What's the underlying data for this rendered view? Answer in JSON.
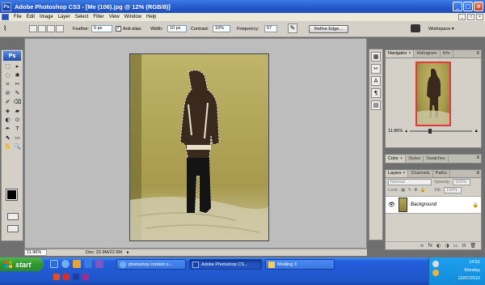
{
  "window": {
    "app_badge": "Ps",
    "title": "Adobe Photoshop CS3 - [Me (106).jpg @ 12% (RGB/8)]",
    "min": "_",
    "max": "□",
    "close": "×"
  },
  "menu": {
    "items": [
      "File",
      "Edit",
      "Image",
      "Layer",
      "Select",
      "Filter",
      "View",
      "Window",
      "Help"
    ]
  },
  "options": {
    "feather_label": "Feather:",
    "feather_value": "0 px",
    "antialias_label": "Anti-alias",
    "antialias_checked": "✓",
    "width_label": "Width:",
    "width_value": "10 px",
    "contrast_label": "Contrast:",
    "contrast_value": "10%",
    "frequency_label": "Frequency:",
    "frequency_value": "57",
    "refine_edge": "Refine Edge...",
    "workspace_label": "Workspace ▾"
  },
  "toolbox": {
    "logo": "Ps",
    "tools": [
      "⬚",
      "▸",
      "◌",
      "✱",
      "⌗",
      "✂",
      "⊘",
      "✎",
      "✐",
      "⌫",
      "◈",
      "▰",
      "◐",
      "⊙",
      "✒",
      "T",
      "⬉",
      "▭",
      "✋",
      "🔍"
    ]
  },
  "status": {
    "zoom": "11.96%",
    "doc": "Doc: 22.9M/22.9M"
  },
  "navigator": {
    "tabs": [
      "Navigator",
      "Histogram",
      "Info"
    ],
    "zoom": "11.96%"
  },
  "color_panel": {
    "tabs": [
      "Color",
      "Styles",
      "Swatches"
    ]
  },
  "layers_panel": {
    "tabs": [
      "Layers",
      "Channels",
      "Paths"
    ],
    "blend_mode": "Normal",
    "opacity_label": "Opacity:",
    "opacity_value": "100%",
    "lock_label": "Lock:",
    "fill_label": "Fill:",
    "fill_value": "100%",
    "layer_name": "Background",
    "footer_icons": [
      "∞",
      "fx",
      "◐",
      "◑",
      "▭",
      "⊡",
      "🗑"
    ]
  },
  "taskbar": {
    "start": "start",
    "items": [
      {
        "label": "photoshop contest o...",
        "active": false
      },
      {
        "label": "Adobe Photoshop CS...",
        "active": true
      },
      {
        "label": "Modling 3",
        "active": false
      }
    ],
    "time": "14:51",
    "day": "Monday",
    "date": "12/07/2010"
  },
  "colors": {
    "title_blue": "#2457c8",
    "start_green": "#2f962f",
    "selection_red": "#e23a3a"
  }
}
